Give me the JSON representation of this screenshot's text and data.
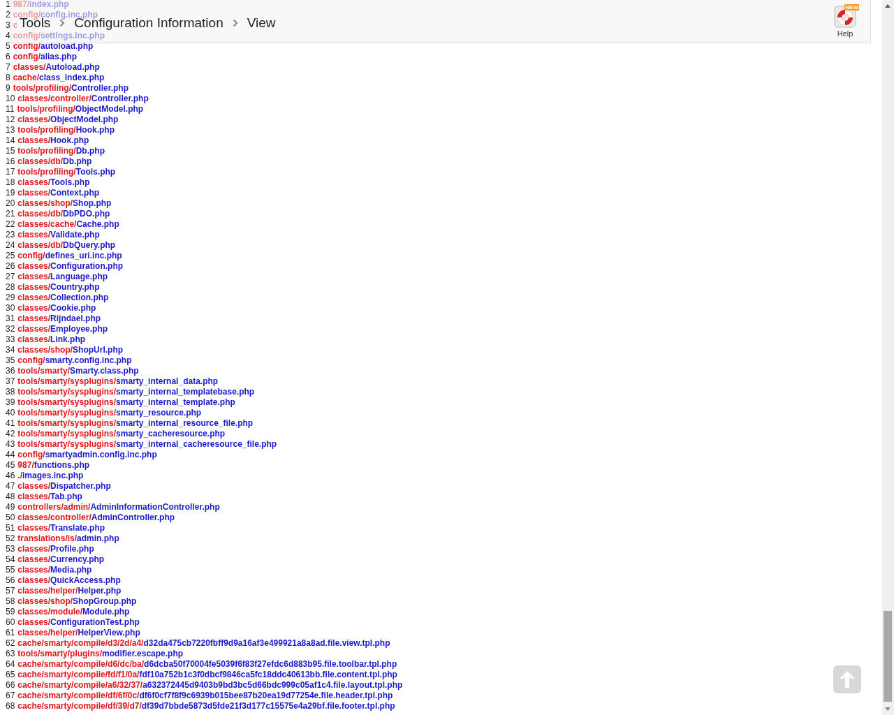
{
  "breadcrumb": [
    {
      "label": "Tools"
    },
    {
      "label": "Configuration Information"
    },
    {
      "label": "View"
    }
  ],
  "help": {
    "label": "Help",
    "badge": "NEW"
  },
  "files": [
    {
      "number": "1",
      "dir": "987/",
      "file": "index.php"
    },
    {
      "number": "2",
      "dir": "config/",
      "file": "config.inc.php"
    },
    {
      "number": "3",
      "dir": "c"
    },
    {
      "number": "4",
      "dir": "config/",
      "file": "settings.inc.php"
    },
    {
      "number": "5",
      "dir": "config/",
      "file": "autoload.php"
    },
    {
      "number": "6",
      "dir": "config/",
      "file": "alias.php"
    },
    {
      "number": "7",
      "dir": "classes/",
      "file": "Autoload.php"
    },
    {
      "number": "8",
      "dir": "cache/",
      "file": "class_index.php"
    },
    {
      "number": "9",
      "dir": "tools/profiling/",
      "file": "Controller.php"
    },
    {
      "number": "10",
      "dir": "classes/controller/",
      "file": "Controller.php"
    },
    {
      "number": "11",
      "dir": "tools/profiling/",
      "file": "ObjectModel.php"
    },
    {
      "number": "12",
      "dir": "classes/",
      "file": "ObjectModel.php"
    },
    {
      "number": "13",
      "dir": "tools/profiling/",
      "file": "Hook.php"
    },
    {
      "number": "14",
      "dir": "classes/",
      "file": "Hook.php"
    },
    {
      "number": "15",
      "dir": "tools/profiling/",
      "file": "Db.php"
    },
    {
      "number": "16",
      "dir": "classes/db/",
      "file": "Db.php"
    },
    {
      "number": "17",
      "dir": "tools/profiling/",
      "file": "Tools.php"
    },
    {
      "number": "18",
      "dir": "classes/",
      "file": "Tools.php"
    },
    {
      "number": "19",
      "dir": "classes/",
      "file": "Context.php"
    },
    {
      "number": "20",
      "dir": "classes/shop/",
      "file": "Shop.php"
    },
    {
      "number": "21",
      "dir": "classes/db/",
      "file": "DbPDO.php"
    },
    {
      "number": "22",
      "dir": "classes/cache/",
      "file": "Cache.php"
    },
    {
      "number": "23",
      "dir": "classes/",
      "file": "Validate.php"
    },
    {
      "number": "24",
      "dir": "classes/db/",
      "file": "DbQuery.php"
    },
    {
      "number": "25",
      "dir": "config/",
      "file": "defines_uri.inc.php"
    },
    {
      "number": "26",
      "dir": "classes/",
      "file": "Configuration.php"
    },
    {
      "number": "27",
      "dir": "classes/",
      "file": "Language.php"
    },
    {
      "number": "28",
      "dir": "classes/",
      "file": "Country.php"
    },
    {
      "number": "29",
      "dir": "classes/",
      "file": "Collection.php"
    },
    {
      "number": "30",
      "dir": "classes/",
      "file": "Cookie.php"
    },
    {
      "number": "31",
      "dir": "classes/",
      "file": "Rijndael.php"
    },
    {
      "number": "32",
      "dir": "classes/",
      "file": "Employee.php"
    },
    {
      "number": "33",
      "dir": "classes/",
      "file": "Link.php"
    },
    {
      "number": "34",
      "dir": "classes/shop/",
      "file": "ShopUrl.php"
    },
    {
      "number": "35",
      "dir": "config/",
      "file": "smarty.config.inc.php"
    },
    {
      "number": "36",
      "dir": "tools/smarty/",
      "file": "Smarty.class.php"
    },
    {
      "number": "37",
      "dir": "tools/smarty/sysplugins/",
      "file": "smarty_internal_data.php"
    },
    {
      "number": "38",
      "dir": "tools/smarty/sysplugins/",
      "file": "smarty_internal_templatebase.php"
    },
    {
      "number": "39",
      "dir": "tools/smarty/sysplugins/",
      "file": "smarty_internal_template.php"
    },
    {
      "number": "40",
      "dir": "tools/smarty/sysplugins/",
      "file": "smarty_resource.php"
    },
    {
      "number": "41",
      "dir": "tools/smarty/sysplugins/",
      "file": "smarty_internal_resource_file.php"
    },
    {
      "number": "42",
      "dir": "tools/smarty/sysplugins/",
      "file": "smarty_cacheresource.php"
    },
    {
      "number": "43",
      "dir": "tools/smarty/sysplugins/",
      "file": "smarty_internal_cacheresource_file.php"
    },
    {
      "number": "44",
      "dir": "config/",
      "file": "smartyadmin.config.inc.php"
    },
    {
      "number": "45",
      "dir": "987/",
      "file": "functions.php"
    },
    {
      "number": "46",
      "dir": "./",
      "file": "images.inc.php"
    },
    {
      "number": "47",
      "dir": "classes/",
      "file": "Dispatcher.php"
    },
    {
      "number": "48",
      "dir": "classes/",
      "file": "Tab.php"
    },
    {
      "number": "49",
      "dir": "controllers/admin/",
      "file": "AdminInformationController.php"
    },
    {
      "number": "50",
      "dir": "classes/controller/",
      "file": "AdminController.php"
    },
    {
      "number": "51",
      "dir": "classes/",
      "file": "Translate.php"
    },
    {
      "number": "52",
      "dir": "translations/is/",
      "file": "admin.php"
    },
    {
      "number": "53",
      "dir": "classes/",
      "file": "Profile.php"
    },
    {
      "number": "54",
      "dir": "classes/",
      "file": "Currency.php"
    },
    {
      "number": "55",
      "dir": "classes/",
      "file": "Media.php"
    },
    {
      "number": "56",
      "dir": "classes/",
      "file": "QuickAccess.php"
    },
    {
      "number": "57",
      "dir": "classes/helper/",
      "file": "Helper.php"
    },
    {
      "number": "58",
      "dir": "classes/shop/",
      "file": "ShopGroup.php"
    },
    {
      "number": "59",
      "dir": "classes/module/",
      "file": "Module.php"
    },
    {
      "number": "60",
      "dir": "classes/",
      "file": "ConfigurationTest.php"
    },
    {
      "number": "61",
      "dir": "classes/helper/",
      "file": "HelperView.php"
    },
    {
      "number": "62",
      "dir": "cache/smarty/compile/d3/2d/a4/",
      "file": "d32da475cb7220fbff9d9a16af3e499921a8a8ad.file.view.tpl.php"
    },
    {
      "number": "63",
      "dir": "tools/smarty/plugins/",
      "file": "modifier.escape.php"
    },
    {
      "number": "64",
      "dir": "cache/smarty/compile/d6/dc/ba/",
      "file": "d6dcba50f70004fe5039f6f83f27efdc6d883b95.file.toolbar.tpl.php"
    },
    {
      "number": "65",
      "dir": "cache/smarty/compile/fd/f1/0a/",
      "file": "fdf10a752b1c3f0dbcf9846ca5fc18ddc40613bb.file.content.tpl.php"
    },
    {
      "number": "66",
      "dir": "cache/smarty/compile/a6/32/37/",
      "file": "a632372445d9403b9bd3bc5d66bdc999c05af1c4.file.layout.tpl.php"
    },
    {
      "number": "67",
      "dir": "cache/smarty/compile/df/6f/0c/",
      "file": "df6f0cf7f8f9c6939b015bee87b20ea19d77254e.file.header.tpl.php"
    },
    {
      "number": "68",
      "dir": "cache/smarty/compile/df/39/d7/",
      "file": "df39d7bbde5873d5fde21f3d177c15575e4a29bf.file.footer.tpl.php"
    }
  ]
}
